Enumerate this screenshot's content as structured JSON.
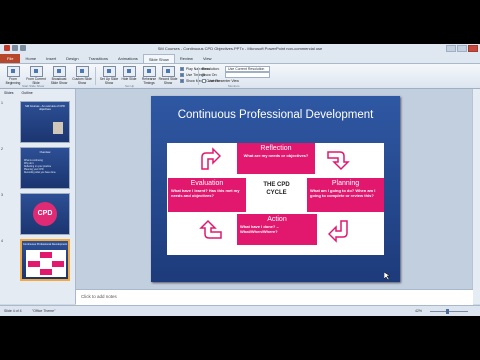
{
  "window": {
    "title": "SM Courses - Continuous CPD Objectives.PPTx - Microsoft PowerPoint non-commercial use"
  },
  "ribbon_tabs": [
    "File",
    "Home",
    "Insert",
    "Design",
    "Transitions",
    "Animations",
    "Slide Show",
    "Review",
    "View"
  ],
  "ribbon": {
    "buttons": [
      {
        "label": "From Beginning",
        "icon": "play-icon"
      },
      {
        "label": "From Current Slide",
        "icon": "play-icon"
      },
      {
        "label": "Broadcast Slide Show",
        "icon": "broadcast-icon"
      },
      {
        "label": "Custom Slide Show",
        "icon": "custom-show-icon"
      },
      {
        "label": "Set Up Slide Show",
        "icon": "setup-icon"
      },
      {
        "label": "Hide Slide",
        "icon": "hide-slide-icon"
      },
      {
        "label": "Rehearse Timings",
        "icon": "timer-icon"
      },
      {
        "label": "Record Slide Show",
        "icon": "record-icon"
      }
    ],
    "group_labels": {
      "start": "Start Slide Show",
      "setup": "Set Up",
      "monitors": "Monitors"
    },
    "checkboxes": [
      {
        "label": "Play Narrations",
        "checked": true
      },
      {
        "label": "Use Timings",
        "checked": true
      },
      {
        "label": "Show Media Controls",
        "checked": true
      }
    ],
    "monitors": {
      "resolution_label": "Resolution:",
      "resolution_value": "Use Current Resolution",
      "show_on_label": "Show On:",
      "presenter_view": "Use Presenter View"
    }
  },
  "panel_tabs": [
    "Slides",
    "Outline"
  ],
  "thumbnails": [
    {
      "num": "1",
      "title": "SM Courses - An overview of CPD objectives",
      "lines": []
    },
    {
      "num": "2",
      "title": "Overview",
      "lines": [
        "What is continuing",
        "Why do it",
        "Reflecting on your practice",
        "Planning your CPD",
        "Recording what you have done"
      ]
    },
    {
      "num": "3",
      "title": "CPD",
      "lines": []
    },
    {
      "num": "4",
      "title": "Continuous Professional Development",
      "lines": []
    }
  ],
  "slide": {
    "title": "Continuous Professional Development",
    "center": "THE CPD CYCLE",
    "reflection": {
      "heading": "Reflection",
      "body": "What are my needs or objectives?"
    },
    "planning": {
      "heading": "Planning",
      "body": "What am I going to do? When am I going to complete or review this?"
    },
    "action": {
      "heading": "Action",
      "body": "What have I done? – What/When/Where?"
    },
    "evaluation": {
      "heading": "Evaluation",
      "body": "What have I learnt? Has this met my needs and objectives?"
    },
    "colors": {
      "accent": "#e2186e",
      "slide_bg": "#2a4f98"
    }
  },
  "notes_placeholder": "Click to add notes",
  "status": {
    "slide": "Slide 4 of 4",
    "theme": "\"Office Theme\"",
    "zoom": "42%"
  }
}
